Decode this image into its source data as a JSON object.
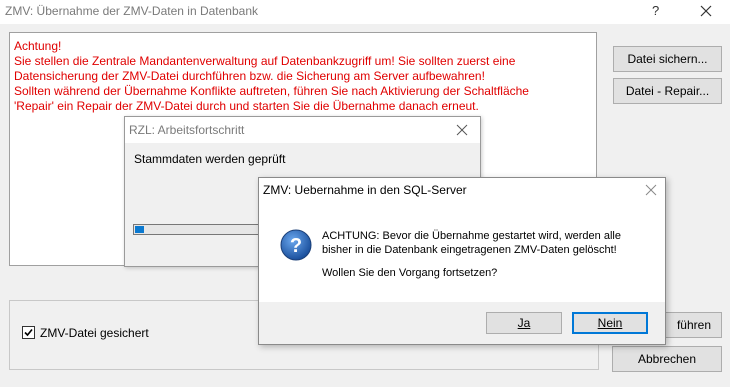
{
  "window": {
    "title": "ZMV: Übernahme der ZMV-Daten in Datenbank",
    "help": "?"
  },
  "warning": {
    "lines": [
      "Achtung!",
      "Sie stellen die Zentrale Mandantenverwaltung auf Datenbankzugriff um! Sie sollten zuerst eine",
      "Datensicherung der ZMV-Datei durchführen bzw. die Sicherung am Server aufbewahren!",
      "Sollten während der Übernahme Konflikte auftreten, führen Sie nach Aktivierung der Schaltfläche",
      "'Repair' ein Repair der ZMV-Datei durch und starten Sie die Übernahme danach erneut."
    ]
  },
  "buttons": {
    "save_file": "Datei sichern...",
    "repair_file": "Datei - Repair...",
    "execute_partial": "führen",
    "cancel": "Abbrechen"
  },
  "checkbox": {
    "label": "ZMV-Datei gesichert",
    "checked": true
  },
  "progress_dialog": {
    "title": "RZL: Arbeitsfortschritt",
    "status": "Stammdaten werden geprüft",
    "progress_fraction": 0.06
  },
  "confirm_dialog": {
    "title": "ZMV: Uebernahme in den SQL-Server",
    "message_lines": [
      "ACHTUNG: Bevor die Übernahme gestartet wird, werden alle",
      "bisher in die Datenbank eingetragenen ZMV-Daten gelöscht!"
    ],
    "question": "Wollen Sie den Vorgang fortsetzen?",
    "yes_label": "Ja",
    "no_label": "Nein",
    "icon": "question-icon"
  },
  "colors": {
    "warning_text": "#e00000",
    "progress_fill": "#0b79d0",
    "icon_blue": "#1a5fb4",
    "focus_border": "#0078d7"
  }
}
